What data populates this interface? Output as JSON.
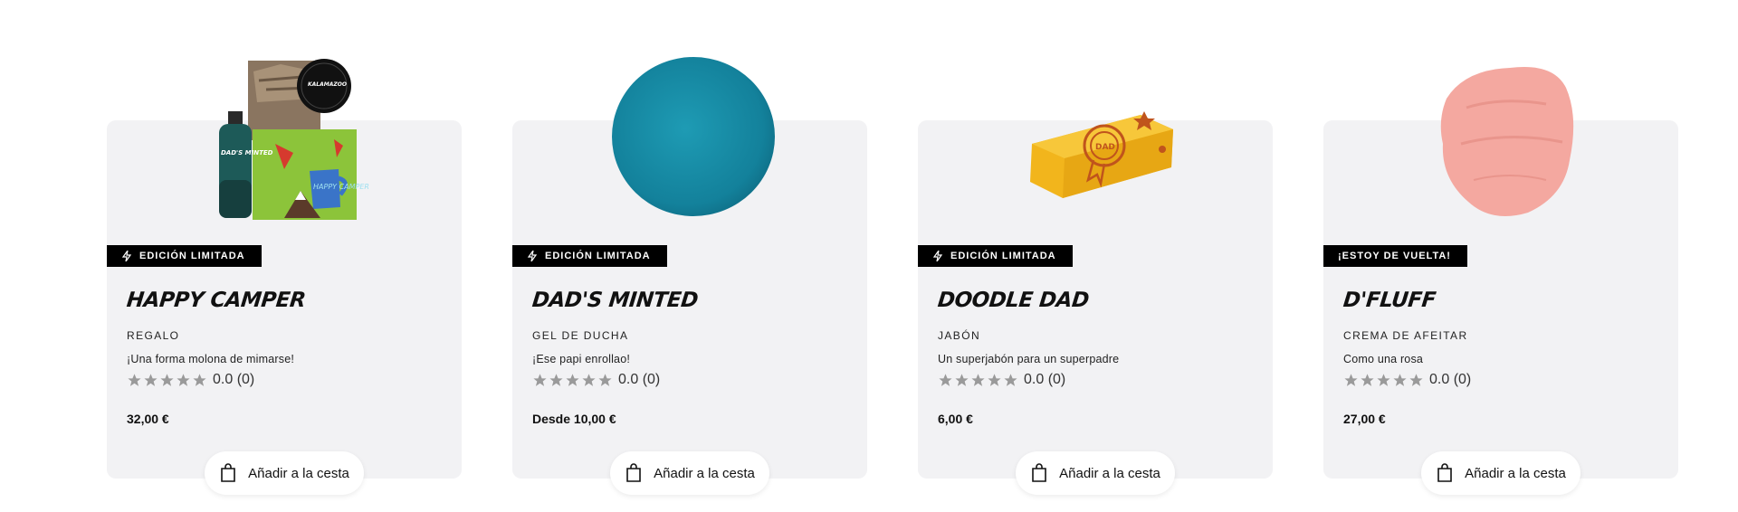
{
  "products": [
    {
      "badge": "EDICIÓN LIMITADA",
      "badge_icon": "lightning-icon",
      "name": "HAPPY CAMPER",
      "category": "REGALO",
      "tagline": "¡Una forma molona de mimarse!",
      "rating": "0.0 (0)",
      "stars": 0,
      "price": "32,00 €",
      "cta": "Añadir a la cesta"
    },
    {
      "badge": "EDICIÓN LIMITADA",
      "badge_icon": "lightning-icon",
      "name": "DAD'S MINTED",
      "category": "GEL DE DUCHA",
      "tagline": "¡Ese papi enrollao!",
      "rating": "0.0 (0)",
      "stars": 0,
      "price": "Desde 10,00 €",
      "cta": "Añadir a la cesta"
    },
    {
      "badge": "EDICIÓN LIMITADA",
      "badge_icon": "lightning-icon",
      "name": "DOODLE DAD",
      "category": "JABÓN",
      "tagline": "Un superjabón para un superpadre",
      "rating": "0.0 (0)",
      "stars": 0,
      "price": "6,00 €",
      "cta": "Añadir a la cesta"
    },
    {
      "badge": "¡ESTOY DE VUELTA!",
      "name": "D'FLUFF",
      "category": "CREMA DE AFEITAR",
      "tagline": "Como una rosa",
      "rating": "0.0 (0)",
      "stars": 0,
      "price": "27,00 €",
      "cta": "Añadir a la cesta"
    }
  ],
  "colors": {
    "card_bg": "#f2f2f4",
    "badge_bg": "#000000",
    "star_empty": "#9a9a9a",
    "teal_soap": "#1a8fa8",
    "yellow_soap": "#f2b51c",
    "pink_cream": "#f4a8a0"
  },
  "product_images": {
    "happy_camper_box_label": "DAD'S MINTED",
    "happy_camper_tin_label": "KALAMAZOO",
    "happy_camper_mug_label": "HAPPY CAMPER",
    "doodle_dad_bar_label": "DAD"
  }
}
